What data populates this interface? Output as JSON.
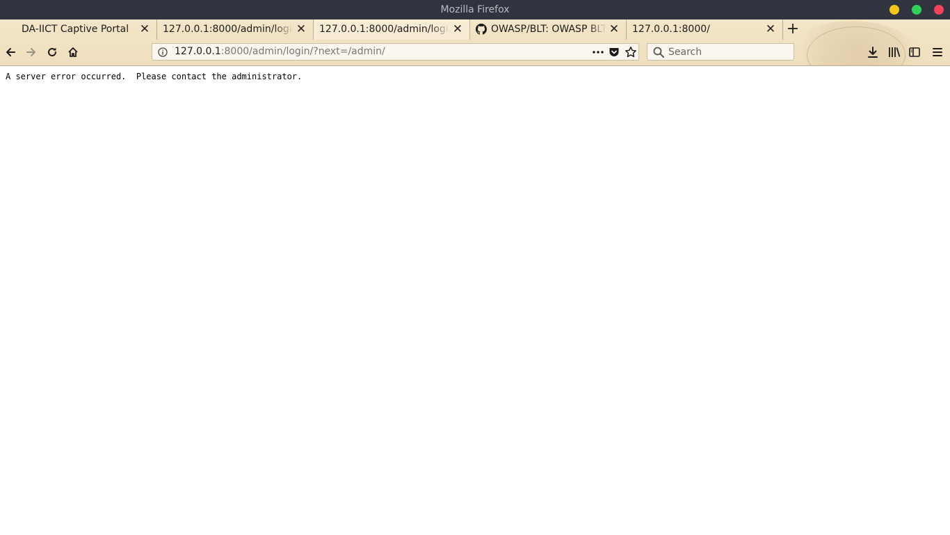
{
  "window": {
    "title": "Mozilla Firefox"
  },
  "tabs": [
    {
      "label": "DA-IICT Captive Portal"
    },
    {
      "label": "127.0.0.1:8000/admin/login/?next=/admin/"
    },
    {
      "label": "127.0.0.1:8000/admin/login/?next=/admin/"
    },
    {
      "label": "OWASP/BLT: OWASP BLT",
      "icon": "github-icon"
    },
    {
      "label": "127.0.0.1:8000/"
    }
  ],
  "navbar": {
    "url_host": "127.0.0.1",
    "url_rest": ":8000/admin/login/?next=/admin/",
    "search_placeholder": "Search"
  },
  "page": {
    "message": "A server error occurred.  Please contact the administrator."
  },
  "colors": {
    "titlebar": "#2f343f",
    "minimize": "#f5c518",
    "maximize": "#30d158",
    "close": "#f4425a"
  }
}
